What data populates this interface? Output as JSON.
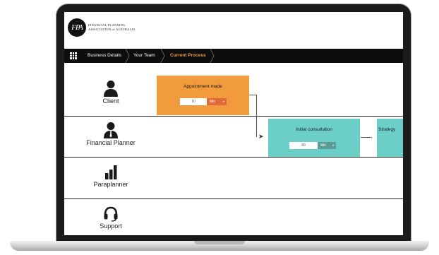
{
  "logo": {
    "mark": "FPA",
    "line1": "FINANCIAL PLANNING",
    "line2": "ASSOCIATION of AUSTRALIA"
  },
  "nav": {
    "crumbs": [
      "Business Details",
      "Your Team",
      "Current Process"
    ],
    "current_index": 2
  },
  "roles": [
    {
      "label": "Client",
      "icon": "person-icon"
    },
    {
      "label": "Financial Planner",
      "icon": "person-tie-icon"
    },
    {
      "label": "Paraplanner",
      "icon": "bar-chart-icon"
    },
    {
      "label": "Support",
      "icon": "headset-icon"
    }
  ],
  "steps": [
    {
      "title": "Appointment made",
      "duration": "10",
      "unit": "Min",
      "color": "#f29b3d",
      "unit_color": "#e2693a"
    },
    {
      "title": "Initial consultation",
      "duration": "60",
      "unit": "Min",
      "color": "#6ccfc7",
      "unit_color": "#5b9b96"
    },
    {
      "title": "Strategy",
      "color": "#6ccfc7"
    }
  ],
  "colors": {
    "navbar": "#0d0d0d",
    "current_crumb": "#f29a3a"
  }
}
